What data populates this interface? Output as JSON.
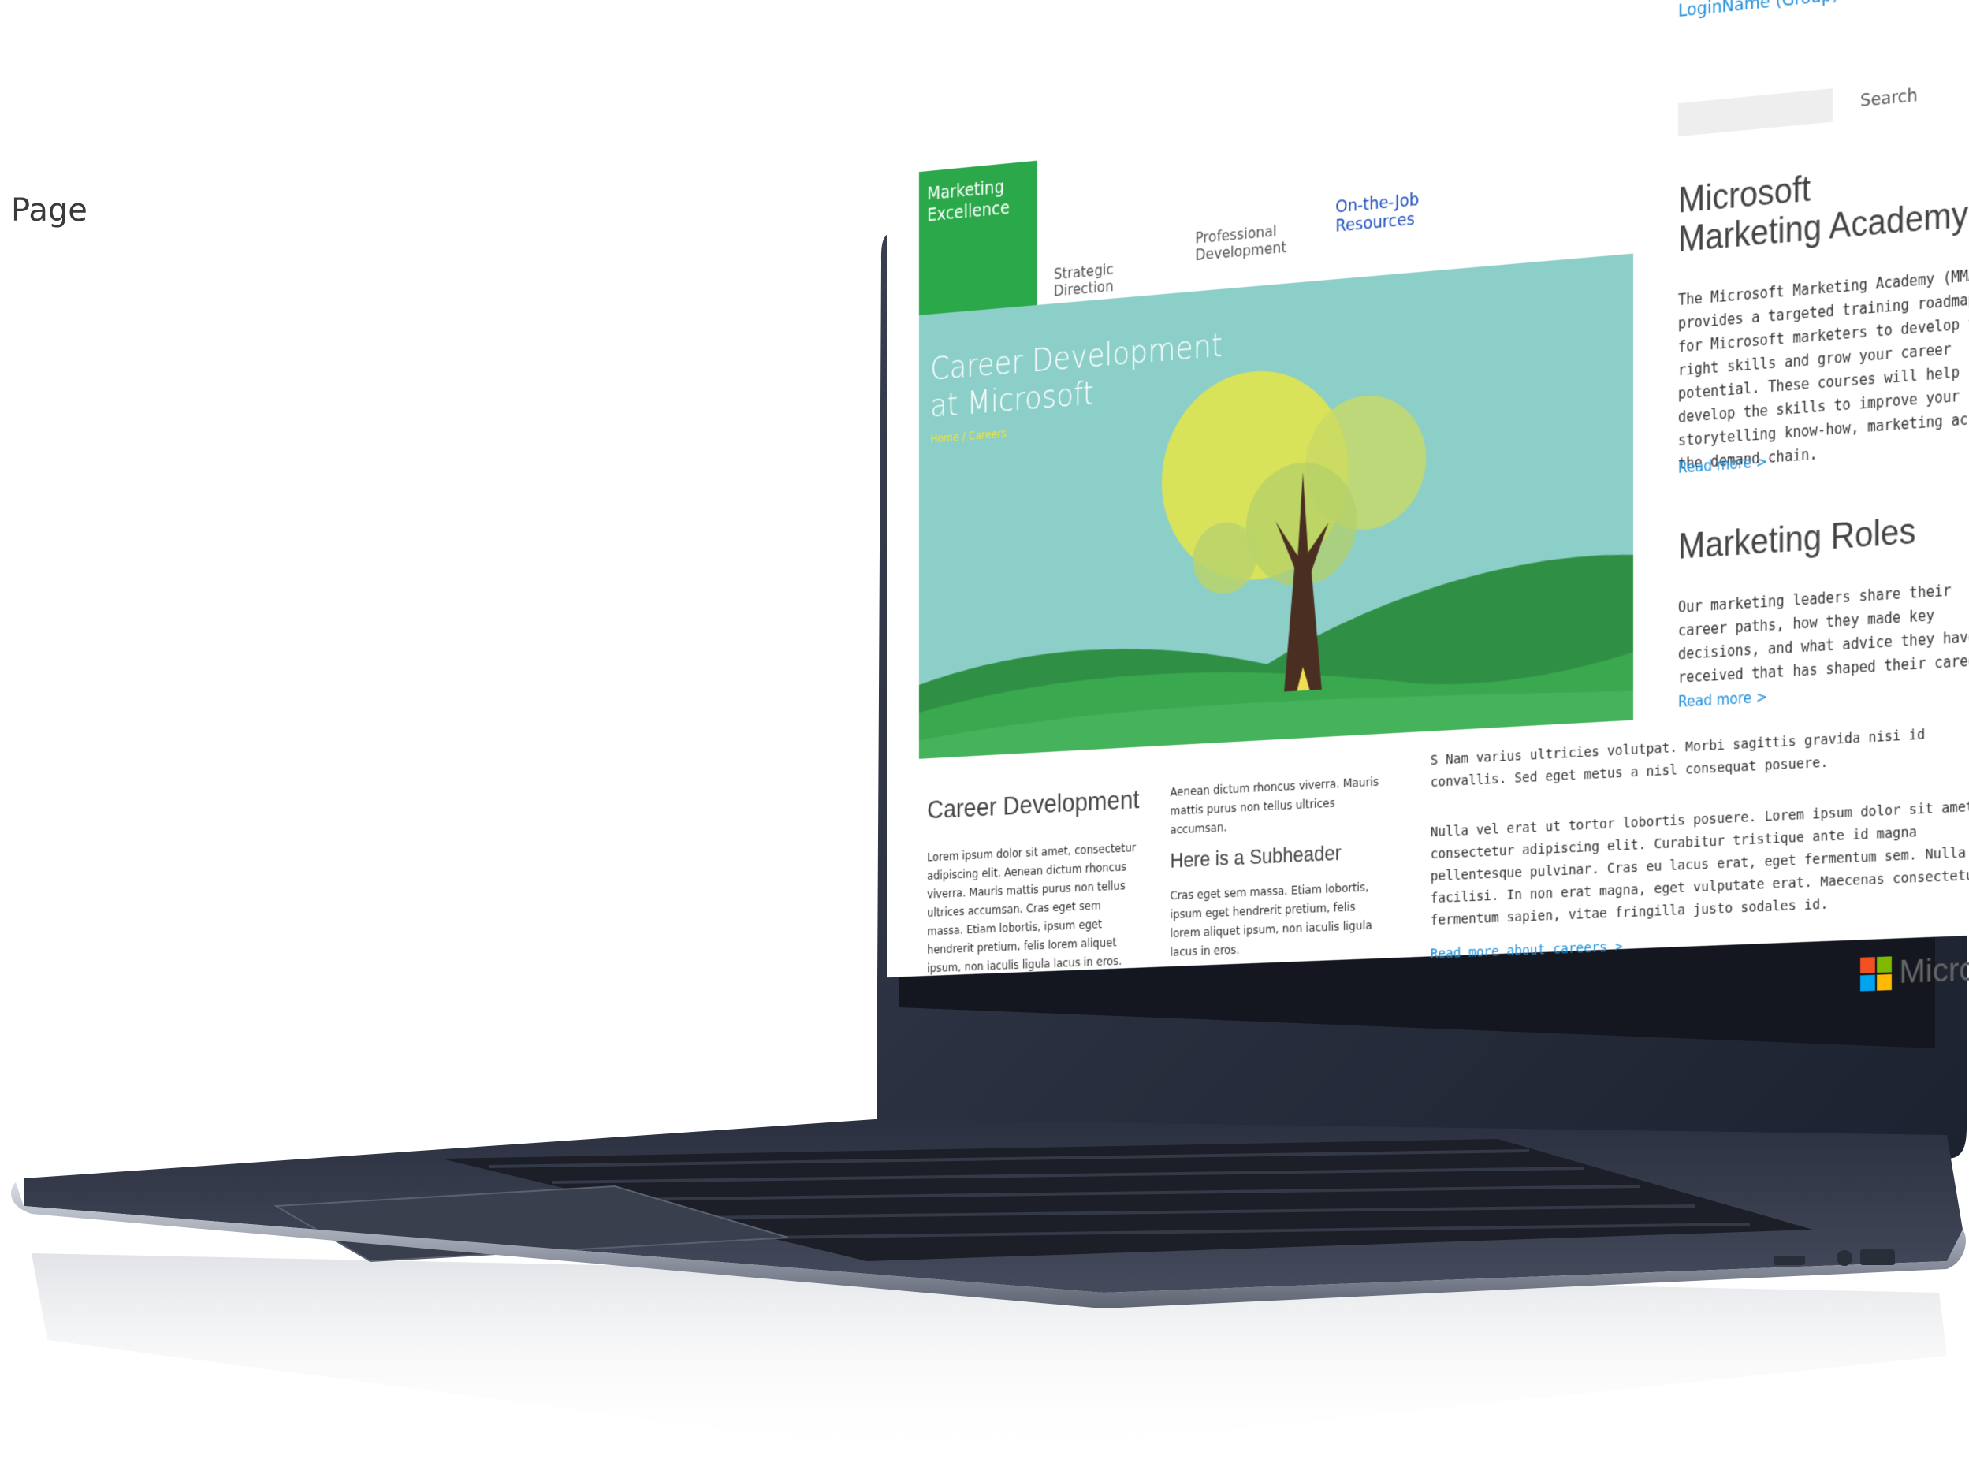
{
  "page_label": "Page",
  "header": {
    "login_name": "LoginName (Group)",
    "search_label": "Search"
  },
  "nav": {
    "brand_tile": "Marketing Excellence",
    "items": [
      "Strategic Direction",
      "Professional Development",
      "On-the-Job Resources"
    ],
    "active": "On-the-Job Resources"
  },
  "hero": {
    "title_line1": "Career Development",
    "title_line2": "at Microsoft",
    "breadcrumb": "Home / Careers"
  },
  "sidebar": {
    "academy_title_line1": "Microsoft",
    "academy_title_line2": "Marketing Academy",
    "academy_text": "The Microsoft Marketing Academy (MMA) provides a targeted training roadmap for Microsoft marketers to develop the right skills and grow your career potential.  These courses will help develop the skills to improve your storytelling know-how, marketing across the demand chain.",
    "academy_link": "Read more >",
    "roles_title": "Marketing Roles",
    "roles_text": "Our marketing leaders share their career paths, how they made key decisions, and what advice they have received that has shaped their careers.",
    "roles_link": "Read more >"
  },
  "content": {
    "career_title": "Career Development",
    "col1_text": "Lorem ipsum dolor sit amet, consectetur adipiscing elit. Aenean dictum rhoncus viverra. Mauris mattis purus non tellus ultrices accumsan. Cras eget sem massa. Etiam lobortis, ipsum eget hendrerit pretium, felis lorem aliquet ipsum, non iaculis ligula lacus in eros.",
    "col2_text": "Aenean dictum rhoncus viverra. Mauris mattis purus non tellus ultrices accumsan.",
    "subheader": "Here is a Subheader",
    "col2_text2": "Cras eget sem massa. Etiam lobortis, ipsum eget hendrerit pretium, felis lorem aliquet ipsum, non iaculis ligula lacus in eros.",
    "col3_text": "S Nam varius ultricies volutpat. Morbi sagittis gravida nisi id convallis. Sed eget metus a nisl consequat posuere.",
    "col3_text2": "Nulla vel erat ut tortor lobortis posuere. Lorem ipsum dolor sit amet, consectetur adipiscing elit. Curabitur tristique ante id magna pellentesque pulvinar. Cras eu lacus erat, eget fermentum sem. Nulla facilisi. In non erat magna, eget vulputate erat. Maecenas consectetur fermentum sapien, vitae fringilla justo sodales id.",
    "col3_link": "Read more about careers >"
  },
  "footer": {
    "logo_text": "Microsoft",
    "logo_colors": [
      "#f25022",
      "#7fba00",
      "#00a4ef",
      "#ffb900"
    ]
  },
  "colors": {
    "accent_green": "#2ba84a",
    "link_blue": "#1f8ed8",
    "nav_active": "#1e4fbf",
    "breadcrumb_yellow": "#f2e23a"
  }
}
